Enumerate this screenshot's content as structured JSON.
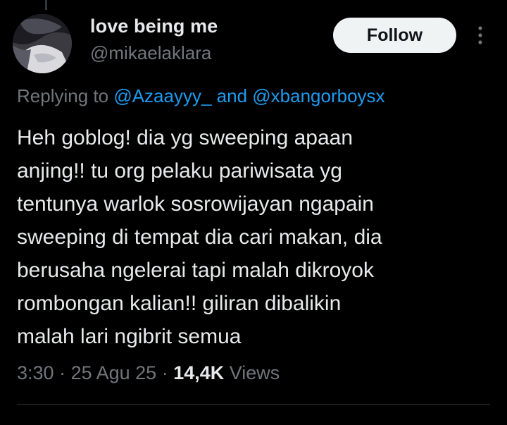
{
  "author": {
    "display_name": "love being me",
    "handle": "@mikaelaklara"
  },
  "header": {
    "follow_label": "Follow",
    "more_icon": "more-vertical-icon"
  },
  "reply": {
    "prefix": "Replying to ",
    "mention_1": "@Azaayyy_",
    "connector": " and ",
    "mention_2": "@xbangorboysx"
  },
  "tweet": {
    "text": "Heh goblog! dia yg sweeping apaan\nanjing!! tu org pelaku pariwisata yg\ntentunya warlok sosrowijayan ngapain\nsweeping di tempat dia cari makan, dia\nberusaha ngelerai tapi malah dikroyok\nrombongan kalian!! giliran dibalikin\nmalah lari ngibrit semua"
  },
  "meta": {
    "time": "3:30",
    "separator": " · ",
    "date": "25 Agu 25",
    "views_count": "14,4K",
    "views_label": " Views"
  },
  "colors": {
    "background": "#000000",
    "text": "#e7e9ea",
    "muted": "#71767b",
    "link": "#1d9bf0",
    "follow_bg": "#eff3f4"
  }
}
